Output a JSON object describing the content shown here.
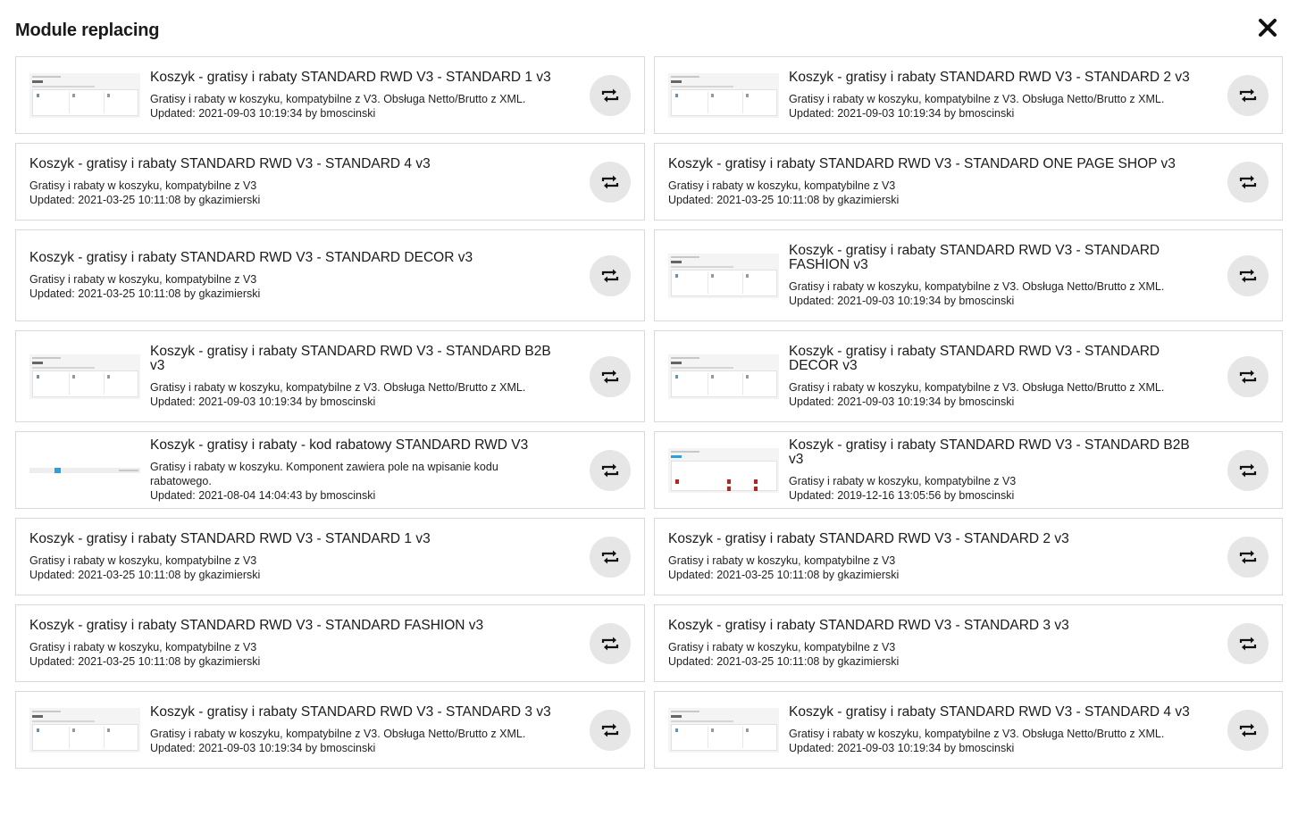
{
  "title": "Module replacing",
  "close_icon": "close-icon",
  "swap_icon": "swap-icon",
  "modules": [
    {
      "thumb": "cart",
      "name": "Koszyk - gratisy i rabaty STANDARD RWD V3 - STANDARD 1 v3",
      "desc": "Gratisy i rabaty w koszyku, kompatybilne z V3. Obsługa Netto/Brutto z XML.",
      "updated": "Updated: 2021-09-03 10:19:34 by bmoscinski"
    },
    {
      "thumb": "cart",
      "name": "Koszyk - gratisy i rabaty STANDARD RWD V3 - STANDARD 2 v3",
      "desc": "Gratisy i rabaty w koszyku, kompatybilne z V3. Obsługa Netto/Brutto z XML.",
      "updated": "Updated: 2021-09-03 10:19:34 by bmoscinski"
    },
    {
      "thumb": null,
      "name": "Koszyk - gratisy i rabaty STANDARD RWD V3 - STANDARD 4 v3",
      "desc": "Gratisy i rabaty w koszyku, kompatybilne z V3",
      "updated": "Updated: 2021-03-25 10:11:08 by gkazimierski"
    },
    {
      "thumb": null,
      "name": "Koszyk - gratisy i rabaty STANDARD RWD V3 - STANDARD ONE PAGE SHOP v3",
      "desc": "Gratisy i rabaty w koszyku, kompatybilne z V3",
      "updated": "Updated: 2021-03-25 10:11:08 by gkazimierski"
    },
    {
      "thumb": null,
      "name": "Koszyk - gratisy i rabaty STANDARD RWD V3 - STANDARD DECOR v3",
      "desc": "Gratisy i rabaty w koszyku, kompatybilne z V3",
      "updated": "Updated: 2021-03-25 10:11:08 by gkazimierski"
    },
    {
      "thumb": "cart",
      "name": "Koszyk - gratisy i rabaty STANDARD RWD V3 - STANDARD FASHION v3",
      "desc": "Gratisy i rabaty w koszyku, kompatybilne z V3. Obsługa Netto/Brutto z XML.",
      "updated": "Updated: 2021-09-03 10:19:34 by bmoscinski"
    },
    {
      "thumb": "cart",
      "name": "Koszyk - gratisy i rabaty STANDARD RWD V3 - STANDARD B2B v3",
      "desc": "Gratisy i rabaty w koszyku, kompatybilne z V3. Obsługa Netto/Brutto z XML.",
      "updated": "Updated: 2021-09-03 10:19:34 by bmoscinski"
    },
    {
      "thumb": "cart",
      "name": "Koszyk - gratisy i rabaty STANDARD RWD V3 - STANDARD DECOR v3",
      "desc": "Gratisy i rabaty w koszyku, kompatybilne z V3. Obsługa Netto/Brutto z XML.",
      "updated": "Updated: 2021-09-03 10:19:34 by bmoscinski"
    },
    {
      "thumb": "promo",
      "name": "Koszyk - gratisy i rabaty - kod rabatowy STANDARD RWD V3",
      "desc": "Gratisy i rabaty w koszyku. Komponent zawiera pole na wpisanie kodu rabatowego.",
      "updated": "Updated: 2021-08-04 14:04:43 by bmoscinski"
    },
    {
      "thumb": "b2b",
      "name": "Koszyk - gratisy i rabaty STANDARD RWD V3 - STANDARD B2B v3",
      "desc": "Gratisy i rabaty w koszyku, kompatybilne z V3",
      "updated": "Updated: 2019-12-16 13:05:56 by bmoscinski"
    },
    {
      "thumb": null,
      "name": "Koszyk - gratisy i rabaty STANDARD RWD V3 - STANDARD 1 v3",
      "desc": "Gratisy i rabaty w koszyku, kompatybilne z V3",
      "updated": "Updated: 2021-03-25 10:11:08 by gkazimierski"
    },
    {
      "thumb": null,
      "name": "Koszyk - gratisy i rabaty STANDARD RWD V3 - STANDARD 2 v3",
      "desc": "Gratisy i rabaty w koszyku, kompatybilne z V3",
      "updated": "Updated: 2021-03-25 10:11:08 by gkazimierski"
    },
    {
      "thumb": null,
      "name": "Koszyk - gratisy i rabaty STANDARD RWD V3 - STANDARD FASHION v3",
      "desc": "Gratisy i rabaty w koszyku, kompatybilne z V3",
      "updated": "Updated: 2021-03-25 10:11:08 by gkazimierski"
    },
    {
      "thumb": null,
      "name": "Koszyk - gratisy i rabaty STANDARD RWD V3 - STANDARD 3 v3",
      "desc": "Gratisy i rabaty w koszyku, kompatybilne z V3",
      "updated": "Updated: 2021-03-25 10:11:08 by gkazimierski"
    },
    {
      "thumb": "cart",
      "name": "Koszyk - gratisy i rabaty STANDARD RWD V3 - STANDARD 3 v3",
      "desc": "Gratisy i rabaty w koszyku, kompatybilne z V3. Obsługa Netto/Brutto z XML.",
      "updated": "Updated: 2021-09-03 10:19:34 by bmoscinski"
    },
    {
      "thumb": "cart",
      "name": "Koszyk - gratisy i rabaty STANDARD RWD V3 - STANDARD 4 v3",
      "desc": "Gratisy i rabaty w koszyku, kompatybilne z V3. Obsługa Netto/Brutto z XML.",
      "updated": "Updated: 2021-09-03 10:19:34 by bmoscinski"
    }
  ]
}
